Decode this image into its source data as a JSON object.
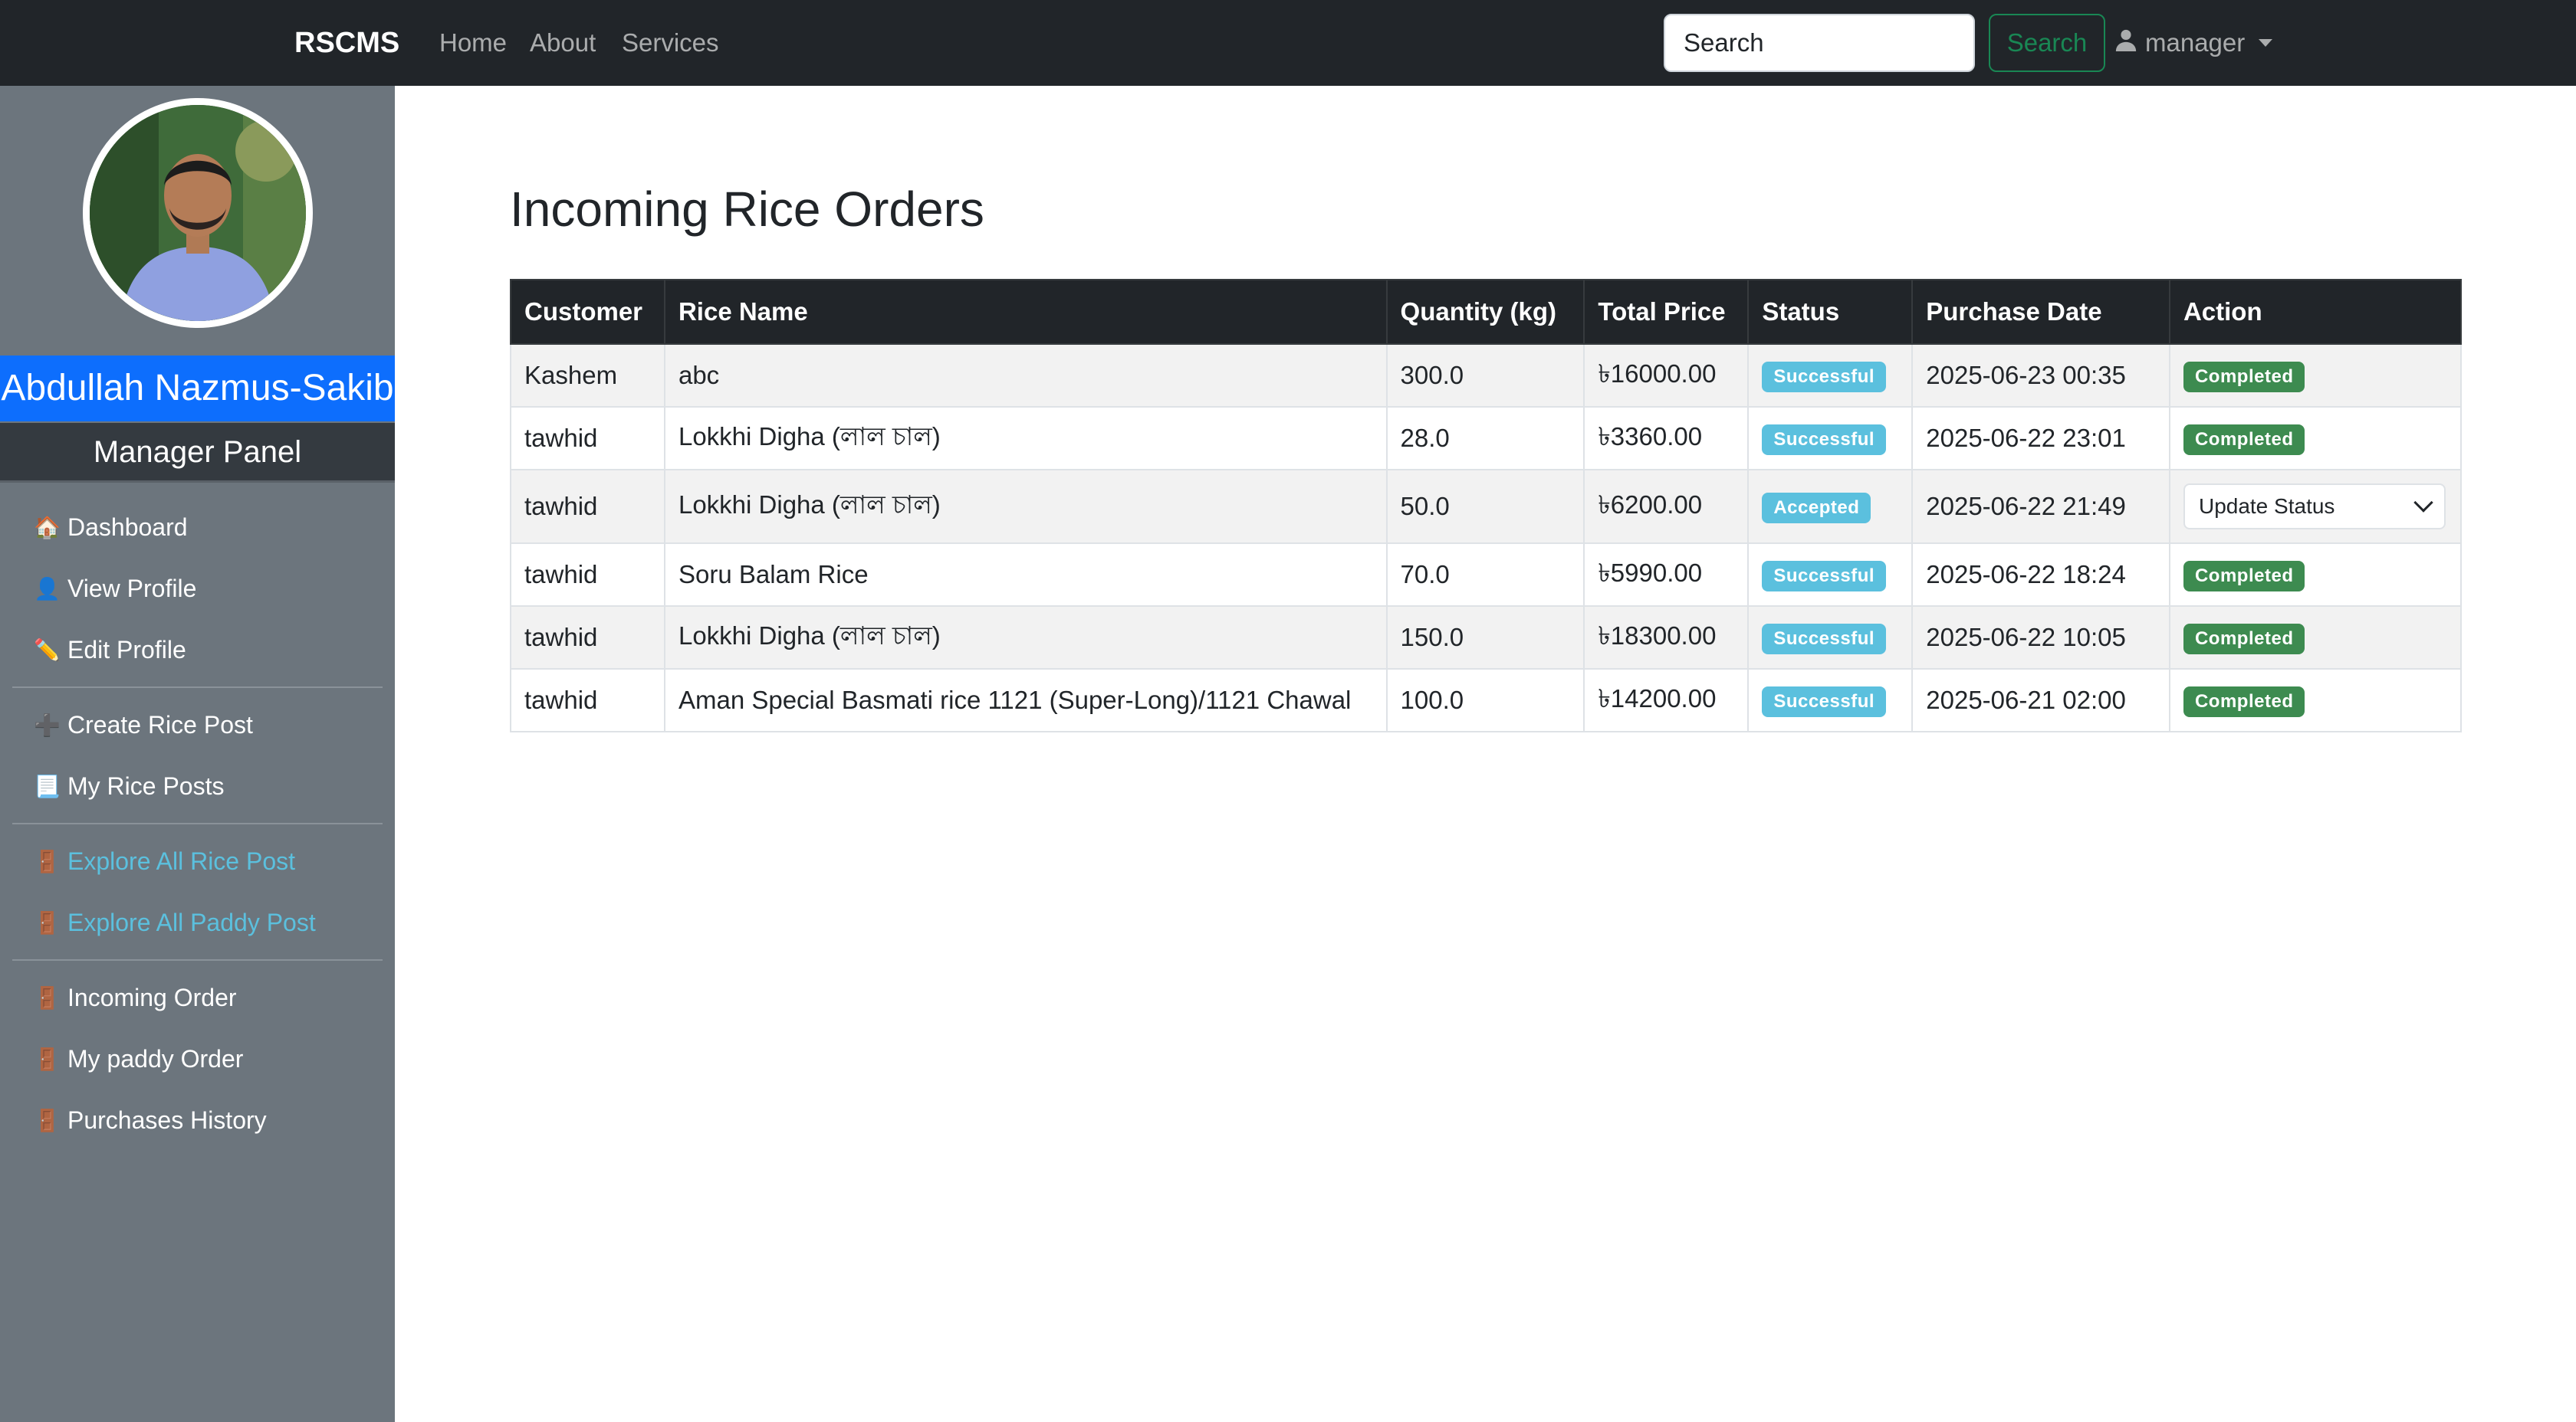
{
  "navbar": {
    "brand": "RSCMS",
    "links": [
      "Home",
      "About",
      "Services"
    ],
    "search_placeholder": "Search",
    "search_button": "Search",
    "user_label": "manager"
  },
  "sidebar": {
    "name": "Abdullah Nazmus-Sakib",
    "panel_title": "Manager Panel",
    "groups": [
      [
        {
          "label": "Dashboard",
          "icon": "house-icon",
          "glyph": "🏠"
        },
        {
          "label": "View Profile",
          "icon": "user-icon",
          "glyph": "👤"
        },
        {
          "label": "Edit Profile",
          "icon": "pencil-icon",
          "glyph": "✏️"
        }
      ],
      [
        {
          "label": "Create Rice Post",
          "icon": "plus-icon",
          "glyph": "➕"
        },
        {
          "label": "My Rice Posts",
          "icon": "scroll-icon",
          "glyph": "📃"
        }
      ],
      [
        {
          "label": "Explore All Rice Post",
          "icon": "door-icon",
          "glyph": "🚪"
        },
        {
          "label": "Explore All Paddy Post",
          "icon": "door-icon",
          "glyph": "🚪"
        }
      ],
      [
        {
          "label": "Incoming Order",
          "icon": "door-icon",
          "glyph": "🚪"
        },
        {
          "label": "My paddy Order",
          "icon": "door-icon",
          "glyph": "🚪"
        },
        {
          "label": "Purchases History",
          "icon": "door-icon",
          "glyph": "🚪"
        }
      ]
    ]
  },
  "main": {
    "title": "Incoming Rice Orders",
    "columns": [
      "Customer",
      "Rice Name",
      "Quantity (kg)",
      "Total Price",
      "Status",
      "Purchase Date",
      "Action"
    ],
    "rows": [
      {
        "customer": "Kashem",
        "rice": "abc",
        "qty": "300.0",
        "price": "৳16000.00",
        "status": "Successful",
        "date": "2025-06-23 00:35",
        "action": "Completed"
      },
      {
        "customer": "tawhid",
        "rice": "Lokkhi Digha (লাল চাল)",
        "qty": "28.0",
        "price": "৳3360.00",
        "status": "Successful",
        "date": "2025-06-22 23:01",
        "action": "Completed"
      },
      {
        "customer": "tawhid",
        "rice": "Lokkhi Digha (লাল চাল)",
        "qty": "50.0",
        "price": "৳6200.00",
        "status": "Accepted",
        "date": "2025-06-22 21:49",
        "action": "Update Status"
      },
      {
        "customer": "tawhid",
        "rice": "Soru Balam Rice",
        "qty": "70.0",
        "price": "৳5990.00",
        "status": "Successful",
        "date": "2025-06-22 18:24",
        "action": "Completed"
      },
      {
        "customer": "tawhid",
        "rice": "Lokkhi Digha (লাল চাল)",
        "qty": "150.0",
        "price": "৳18300.00",
        "status": "Successful",
        "date": "2025-06-22 10:05",
        "action": "Completed"
      },
      {
        "customer": "tawhid",
        "rice": "Aman Special Basmati rice 1121 (Super-Long)/1121 Chawal",
        "qty": "100.0",
        "price": "৳14200.00",
        "status": "Successful",
        "date": "2025-06-21 02:00",
        "action": "Completed"
      }
    ]
  },
  "colors": {
    "navbar": "#212529",
    "sidebar": "#6c757d",
    "name_bar": "#0d6efd",
    "badge_info": "#5bc0de",
    "badge_success": "#3d8b50",
    "search_button": "#198754"
  }
}
